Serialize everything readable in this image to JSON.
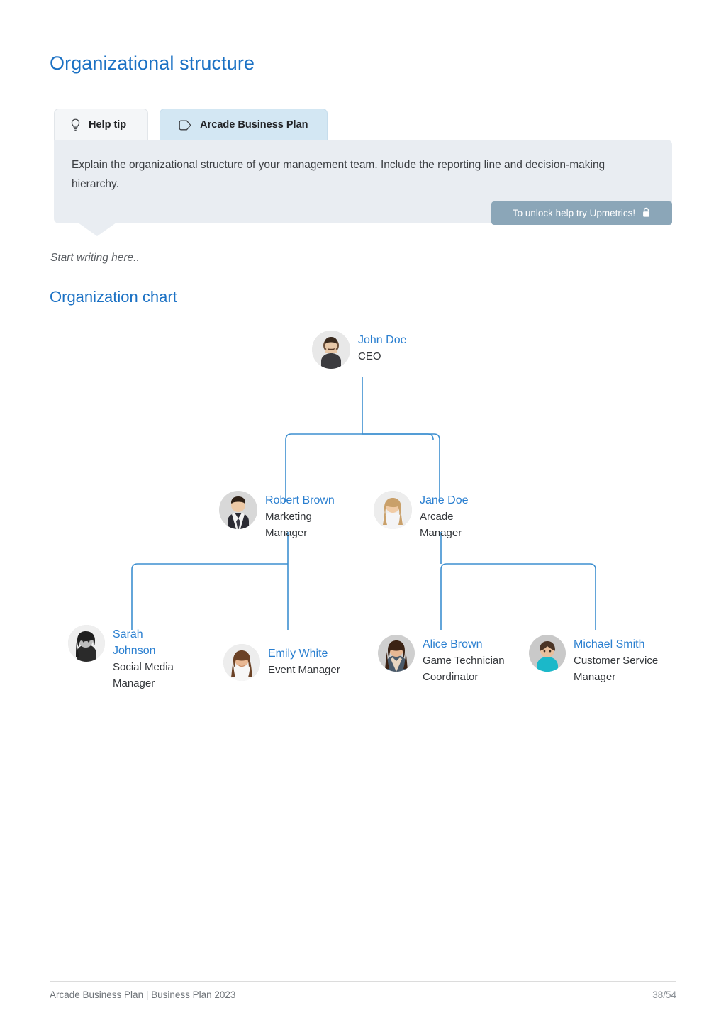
{
  "page_title": "Organizational structure",
  "help_tip": {
    "tabs": [
      {
        "label": "Help tip",
        "icon": "lightbulb-icon",
        "active": false
      },
      {
        "label": "Arcade Business Plan",
        "icon": "tag-icon",
        "active": true
      }
    ],
    "body": "Explain the organizational structure of your management team. Include the reporting line and decision-making hierarchy.",
    "unlock_badge": {
      "label": "To unlock help try Upmetrics!",
      "icon": "lock-icon"
    }
  },
  "editor_placeholder": "Start writing here..",
  "section_title": "Organization chart",
  "chart_data": {
    "type": "tree",
    "title": "Organization chart",
    "accent_color": "#2a7fd0",
    "line_color": "#3d8fd0",
    "nodes": [
      {
        "id": "john",
        "name": "John Doe",
        "role": "CEO",
        "level": 0,
        "parent": null
      },
      {
        "id": "robert",
        "name": "Robert Brown",
        "role": "Marketing\nManager",
        "level": 1,
        "parent": "john"
      },
      {
        "id": "jane",
        "name": "Jane Doe",
        "role": "Arcade\nManager",
        "level": 1,
        "parent": "john"
      },
      {
        "id": "sarah",
        "name": "Sarah\nJohnson",
        "role": "Social Media\nManager",
        "level": 2,
        "parent": "robert"
      },
      {
        "id": "emily",
        "name": "Emily White",
        "role": "Event Manager",
        "level": 2,
        "parent": "robert"
      },
      {
        "id": "alice",
        "name": "Alice Brown",
        "role": "Game Technician\nCoordinator",
        "level": 2,
        "parent": "jane"
      },
      {
        "id": "michael",
        "name": "Michael Smith",
        "role": "Customer Service\nManager",
        "level": 2,
        "parent": "jane"
      }
    ]
  },
  "footer": {
    "left": "Arcade Business Plan | Business Plan 2023",
    "page": "38/54"
  }
}
